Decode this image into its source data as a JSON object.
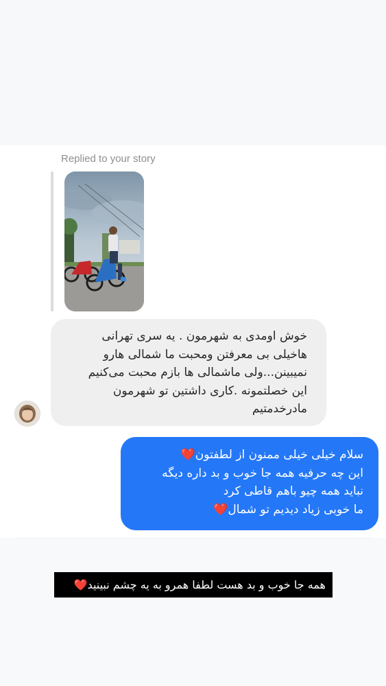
{
  "thread": {
    "replied_label": "Replied to your story",
    "story": {
      "reaction_icon": "heart-eyes-emoji-icon"
    },
    "incoming_message": {
      "lines": [
        "خوش اومدی به شهرمون . یه سری تهرانی",
        "هاخیلی بی معرفتن ومحبت ما شمالی هارو",
        "نمیبینن...ولی ماشمالی ها بازم محبت می‌کنیم",
        "این خصلتمونه .کاری داشتین تو شهرمون",
        "مادرخدمتیم"
      ]
    },
    "outgoing_message": {
      "lines": [
        "سلام خیلی خیلی ممنون از لطفتون",
        "این چه حرفیه همه جا خوب و بد داره دیگه",
        "نباید همه چیو باهم قاطی کرد",
        "ما خوبی زیاد دیدیم تو شمال"
      ],
      "emoji": "❤️"
    }
  },
  "caption": {
    "text": "همه جا خوب و بد هست لطفا همرو به یه چشم نبینید",
    "emoji": "❤️"
  },
  "colors": {
    "outgoing_bubble": "#2478f7",
    "incoming_bubble": "#efefef",
    "caption_bg": "#000000",
    "heart": "#e0152a"
  }
}
